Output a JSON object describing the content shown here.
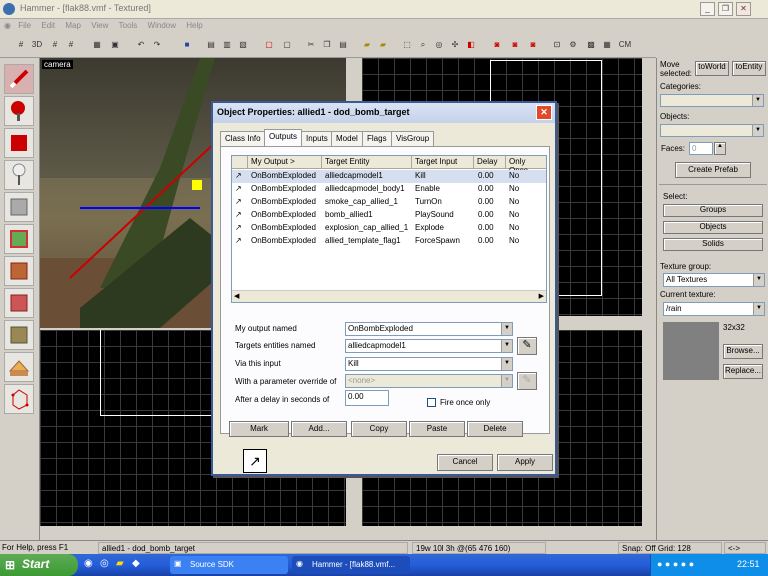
{
  "window": {
    "title": "Hammer - [flak88.vmf - Textured]",
    "controls": [
      "_",
      "❐",
      "✕"
    ]
  },
  "menu": [
    "File",
    "Edit",
    "Map",
    "View",
    "Tools",
    "Window",
    "Help"
  ],
  "toolbar": {
    "grid_label": "3D",
    "cm_label": "CM"
  },
  "viewports": {
    "camera_label": "camera"
  },
  "right_panel": {
    "move_selected_label": "Move selected:",
    "to_world": "toWorld",
    "to_entity": "toEntity",
    "categories_label": "Categories:",
    "objects_label": "Objects:",
    "faces_label": "Faces:",
    "faces_value": "0",
    "create_prefab": "Create Prefab",
    "select_label": "Select:",
    "groups": "Groups",
    "objects": "Objects",
    "solids": "Solids",
    "texture_group_label": "Texture group:",
    "texture_group_value": "All Textures",
    "current_texture_label": "Current texture:",
    "current_texture_value": "/rain",
    "texture_size": "32x32",
    "browse": "Browse...",
    "replace": "Replace..."
  },
  "dialog": {
    "title": "Object Properties: allied1 - dod_bomb_target",
    "close": "✕",
    "tabs": [
      "Class Info",
      "Outputs",
      "Inputs",
      "Model",
      "Flags",
      "VisGroup"
    ],
    "active_tab": "Outputs",
    "columns": [
      "My Output >",
      "Target Entity",
      "Target Input",
      "Delay",
      "Only Once"
    ],
    "rows": [
      [
        "OnBombExploded",
        "alliedcapmodel1",
        "Kill",
        "0.00",
        "No"
      ],
      [
        "OnBombExploded",
        "alliedcapmodel_body1",
        "Enable",
        "0.00",
        "No"
      ],
      [
        "OnBombExploded",
        "smoke_cap_allied_1",
        "TurnOn",
        "0.00",
        "No"
      ],
      [
        "OnBombExploded",
        "bomb_allied1",
        "PlaySound",
        "0.00",
        "No"
      ],
      [
        "OnBombExploded",
        "explosion_cap_allied_1",
        "Explode",
        "0.00",
        "No"
      ],
      [
        "OnBombExploded",
        "allied_template_flag1",
        "ForceSpawn",
        "0.00",
        "No"
      ]
    ],
    "form": {
      "my_output_label": "My output named",
      "my_output_value": "OnBombExploded",
      "targets_label": "Targets entities named",
      "targets_value": "alliedcapmodel1",
      "via_input_label": "Via this input",
      "via_input_value": "Kill",
      "param_label": "With a parameter override of",
      "param_value": "<none>",
      "delay_label": "After a delay in seconds of",
      "delay_value": "0.00",
      "fire_once_label": "Fire once only"
    },
    "buttons": {
      "mark": "Mark",
      "add": "Add...",
      "copy": "Copy",
      "paste": "Paste",
      "delete": "Delete",
      "cancel": "Cancel",
      "apply": "Apply"
    }
  },
  "status": {
    "help": "For Help, press F1",
    "selection": "allied1 - dod_bomb_target",
    "size": "19w 10l 3h @(65 476 160)",
    "snap": "Snap: Off Grid: 128",
    "extra": "<->"
  },
  "taskbar": {
    "start": "Start",
    "tasks": [
      "Source SDK",
      "Hammer - [flak88.vmf..."
    ],
    "clock": "22:51"
  },
  "colors": {
    "grid_bg": "#000000",
    "grid_line": "#3a3a3a",
    "selection": "#ffffff",
    "taskbar": "#245edb"
  }
}
